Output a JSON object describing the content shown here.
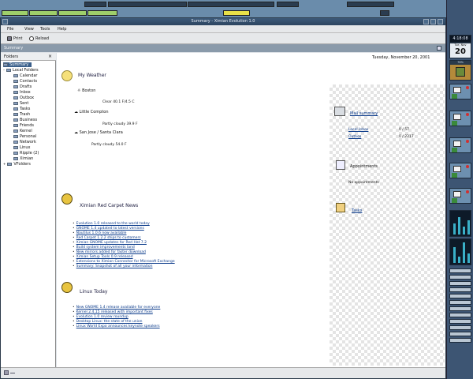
{
  "taskbar": {
    "items": [
      "",
      "",
      "",
      "",
      "",
      "",
      "",
      "",
      ""
    ]
  },
  "window": {
    "title": "Summary - Ximian Evolution 1.0"
  },
  "menubar": {
    "items": [
      "File",
      "View",
      "Tools",
      "Help"
    ]
  },
  "toolbar": {
    "print_label": "Print",
    "reload_label": "Reload"
  },
  "location": {
    "label": "Summary"
  },
  "sidebar": {
    "header": "Folders",
    "items": [
      {
        "label": "Summary",
        "selected": true
      },
      {
        "label": "Local Folders"
      },
      {
        "label": "Calendar"
      },
      {
        "label": "Contacts"
      },
      {
        "label": "Drafts"
      },
      {
        "label": "Inbox"
      },
      {
        "label": "Outbox"
      },
      {
        "label": "Sent"
      },
      {
        "label": "Tasks"
      },
      {
        "label": "Trash"
      },
      {
        "label": "Business"
      },
      {
        "label": "Friends"
      },
      {
        "label": "Kernel"
      },
      {
        "label": "Personal"
      },
      {
        "label": "Network"
      },
      {
        "label": "Linux"
      },
      {
        "label": "Ripple (2)"
      },
      {
        "label": "Ximian"
      },
      {
        "label": "VFolders"
      }
    ]
  },
  "summary": {
    "date": "Tuesday, November 20, 2001",
    "weather": {
      "title": "My Weather",
      "locations": [
        {
          "name": "Boston",
          "detail": "Clear 40.1 F/4.5 C"
        },
        {
          "name": "Little Compton",
          "detail": "Partly cloudy 39.9 F"
        },
        {
          "name": "San Jose / Santa Clara",
          "detail": "Partly cloudy 54.0 F"
        }
      ]
    },
    "news1": {
      "title": "Ximian Red Carpet News",
      "items": [
        "Evolution 1.0 released to the world today",
        "GNOME 1.4 updated to latest versions",
        "Nautilus 1.0.6 now available",
        "Red Carpet 1.2.2 ships to customers",
        "Ximian GNOME updates for Red Hat 7.2",
        "Build system improvements land",
        "New mirrors added for faster download",
        "Ximian Setup Tools 0.9 released",
        "Extensions to Ximian Connector for Microsoft Exchange",
        "Summary: Snapshot of all your information"
      ]
    },
    "news2": {
      "title": "Linux Today",
      "items": [
        "New GNOME 1.4 release available for everyone",
        "Kernel 2.4.15 released with important fixes",
        "Evolution 1.0 review roundup",
        "Desktop Linux: the state of the union",
        "Linux World Expo announces keynote speakers"
      ]
    },
    "mail": {
      "title": "Mail summary",
      "rows": [
        {
          "folder": "Local Inbox",
          "count": "0 / 57"
        },
        {
          "folder": "Outbox",
          "count": "0 / 2217"
        }
      ]
    },
    "appointments": {
      "title": "Appointments",
      "text": "No appointments"
    },
    "tasks": {
      "title": "Tasks"
    }
  },
  "dock": {
    "clock": "4:18:08",
    "day_name": "Tue, Nov",
    "day_num": "20",
    "apm": "78%"
  },
  "colors": {
    "desktop": "#5a7a9c",
    "titlebar": "#2c4560",
    "selection": "#3a5f8a",
    "link": "#0a3a8a",
    "task_green": "#9fcf6a",
    "task_yellow": "#e8e048"
  }
}
